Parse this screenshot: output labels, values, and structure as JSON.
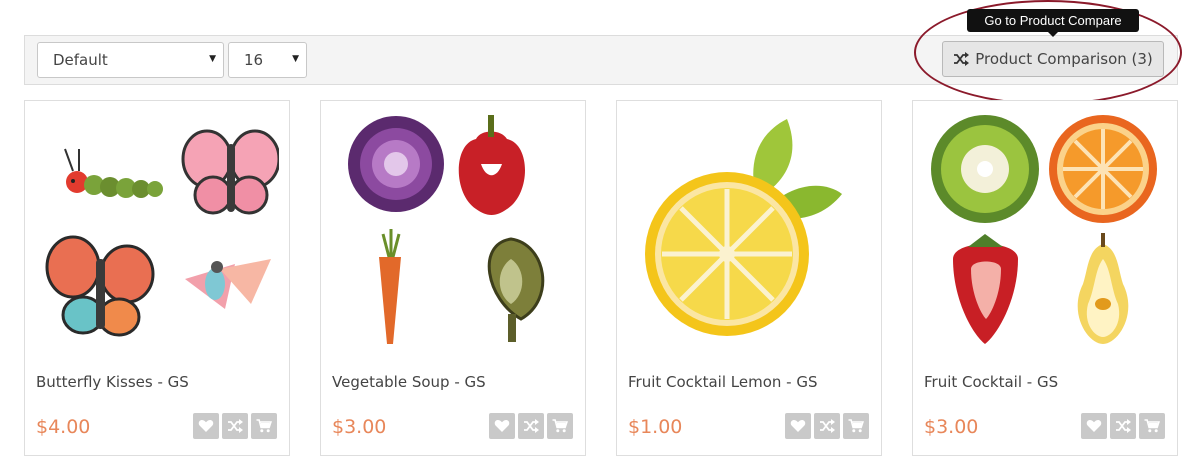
{
  "toolbar": {
    "sort_value": "Default",
    "limit_value": "16",
    "compare_label": "Product Comparison (3)",
    "tooltip": "Go to Product Compare"
  },
  "products": [
    {
      "name": "Butterfly Kisses - GS",
      "price": "$4.00"
    },
    {
      "name": "Vegetable Soup - GS",
      "price": "$3.00"
    },
    {
      "name": "Fruit Cocktail Lemon - GS",
      "price": "$1.00"
    },
    {
      "name": "Fruit Cocktail - GS",
      "price": "$3.00"
    }
  ],
  "colors": {
    "price": "#e8875a",
    "highlight_ring": "#8b1a2b",
    "action_button": "#c9c9c9"
  },
  "icons": [
    "shuffle-icon",
    "heart-icon",
    "compare-icon",
    "cart-icon",
    "caret-down-icon"
  ]
}
